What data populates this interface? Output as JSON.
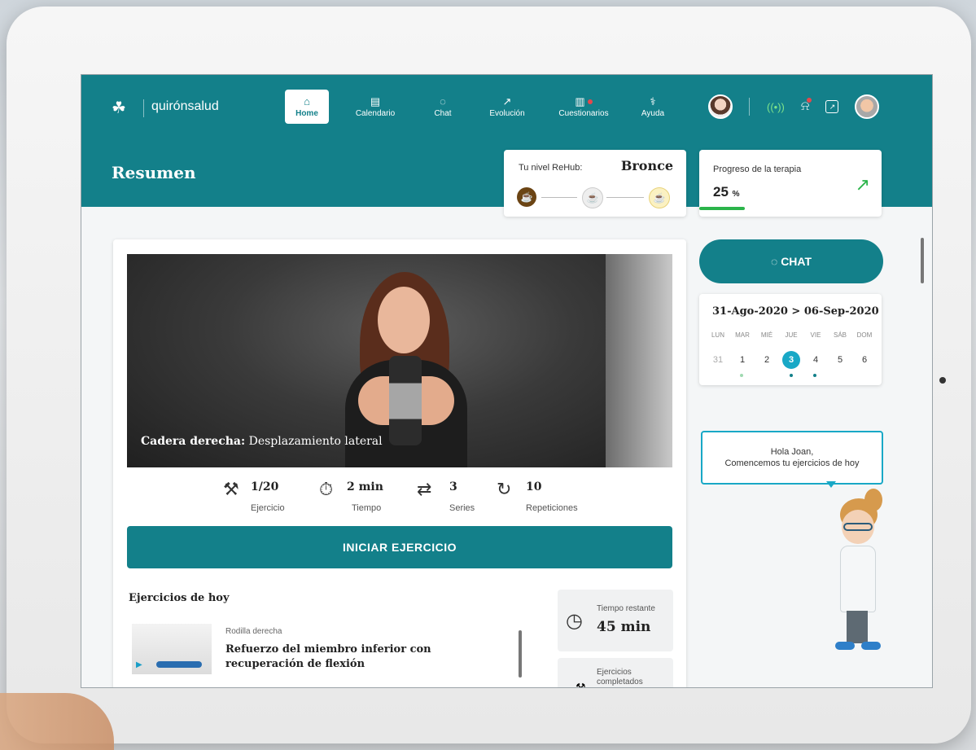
{
  "brand": {
    "name": "quirónsalud"
  },
  "nav": {
    "items": [
      {
        "label": "Home",
        "icon": "home-icon",
        "active": true
      },
      {
        "label": "Calendario",
        "icon": "calendar-icon"
      },
      {
        "label": "Chat",
        "icon": "chat-icon"
      },
      {
        "label": "Evolución",
        "icon": "chart-icon"
      },
      {
        "label": "Cuestionarios",
        "icon": "clipboard-icon",
        "badge": true
      },
      {
        "label": "Ayuda",
        "icon": "help-icon"
      }
    ]
  },
  "header": {
    "title": "Resumen"
  },
  "level": {
    "label": "Tu nivel ReHub:",
    "value": "Bronce",
    "tiers": [
      "bronze",
      "silver",
      "gold"
    ]
  },
  "progress": {
    "label": "Progreso de la terapia",
    "value": "25",
    "unit": "%",
    "fraction": 0.25
  },
  "video": {
    "caption_bold": "Cadera derecha:",
    "caption_text": " Desplazamiento lateral"
  },
  "stats": {
    "exercise": {
      "value": "1/20",
      "label": "Ejercicio"
    },
    "time": {
      "value": "2 min",
      "label": "Tiempo"
    },
    "series": {
      "value": "3",
      "label": "Series"
    },
    "reps": {
      "value": "10",
      "label": "Repeticiones"
    }
  },
  "start_button": "INICIAR EJERCICIO",
  "today": {
    "title": "Ejercicios de hoy",
    "exercise": {
      "region": "Rodilla derecha",
      "name": "Refuerzo del miembro inferior con recuperación de flexión"
    }
  },
  "remaining": {
    "label": "Tiempo restante",
    "value": "45 min"
  },
  "completed": {
    "label": "Ejercicios completados"
  },
  "chat_button": "CHAT",
  "calendar": {
    "range": "31-Ago-2020 > 06-Sep-2020",
    "days": [
      "LUN",
      "MAR",
      "MIÉ",
      "JUE",
      "VIE",
      "SÁB",
      "DOM"
    ],
    "numbers": [
      "31",
      "1",
      "2",
      "3",
      "4",
      "5",
      "6"
    ],
    "selected": "3"
  },
  "assistant": {
    "line1": "Hola Joan,",
    "line2": "Comencemos tu ejercicios de hoy"
  },
  "colors": {
    "primary": "#13808a",
    "accent": "#19a8c6",
    "progress": "#2bb44a",
    "bronze": "#6b4414"
  }
}
